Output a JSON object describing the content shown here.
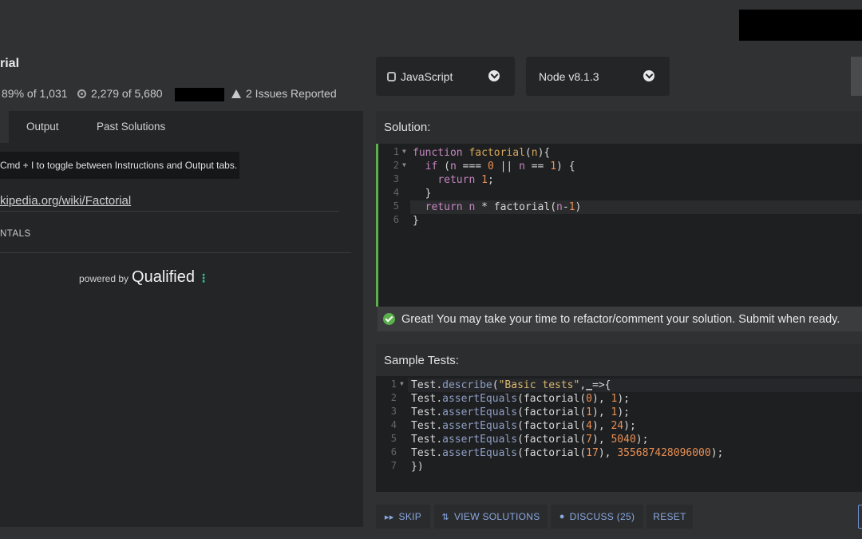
{
  "kata": {
    "title": "rial",
    "satisfaction": "89% of 1,031",
    "completions": "2,279 of 5,680",
    "issues": "2 Issues Reported"
  },
  "left": {
    "tabs": [
      "Output",
      "Past Solutions"
    ],
    "tooltip": "Cmd + I to toggle between Instructions and Output tabs.",
    "link": "kipedia.org/wiki/Factorial",
    "tag": "NTALS",
    "powered_by": "powered by",
    "brand": "Qualified"
  },
  "toolbar": {
    "language": "JavaScript",
    "runtime": "Node v8.1.3"
  },
  "solution": {
    "label": "Solution:",
    "line_numbers": [
      "1",
      "2",
      "3",
      "4",
      "5",
      "6"
    ],
    "success": "Great! You may take your time to refactor/comment your solution. Submit when ready."
  },
  "tests": {
    "label": "Sample Tests:",
    "line_numbers": [
      "1",
      "2",
      "3",
      "4",
      "5",
      "6",
      "7"
    ]
  },
  "code_tokens": {
    "kw_function": "function",
    "fn_factorial": "factorial",
    "n": "n",
    "kw_if": "if",
    "kw_return": "return",
    "n0": "0",
    "n1": "1",
    "n4": "4",
    "n7": "7",
    "n17": "17",
    "r24": "24",
    "r5040": "5040",
    "rbig": "355687428096000",
    "test": "Test",
    "describe": "describe",
    "assertEquals": "assertEquals",
    "basic": "\"Basic tests\""
  },
  "actions": {
    "skip": "SKIP",
    "view_solutions": "VIEW SOLUTIONS",
    "discuss": "DISCUSS (25)",
    "reset": "RESET"
  },
  "colors": {
    "keyword": "#c586c0",
    "function": "#d7a65a",
    "number": "#e98f53",
    "success": "#5ab04b",
    "link_button": "#8aa8e0",
    "brand_dots": "#31c48d"
  }
}
